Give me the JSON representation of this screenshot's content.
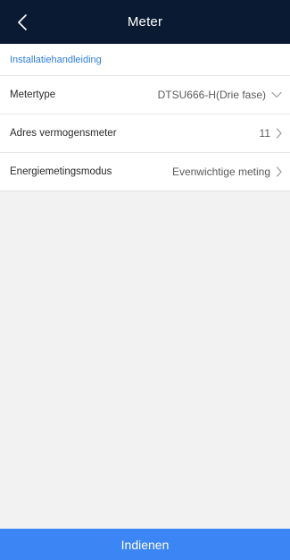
{
  "header": {
    "title": "Meter"
  },
  "install_link": "Installatiehandleiding",
  "settings": [
    {
      "label": "Metertype",
      "value": "DTSU666-H(Drie fase)",
      "icon": "chevron-down-icon"
    },
    {
      "label": "Adres vermogensmeter",
      "value": "11",
      "icon": "chevron-right-icon"
    },
    {
      "label": "Energiemetingsmodus",
      "value": "Evenwichtige meting",
      "icon": "chevron-right-icon"
    }
  ],
  "submit_label": "Indienen",
  "colors": {
    "header_bg": "#0b1a33",
    "link": "#2f7de1",
    "submit_bg": "#3b86f4",
    "page_bg": "#f2f2f2"
  }
}
